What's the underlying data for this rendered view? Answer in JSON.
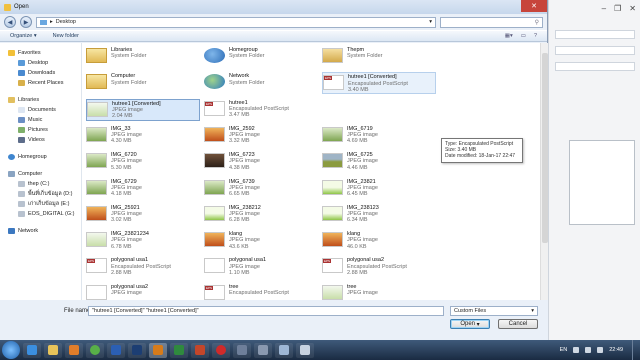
{
  "window": {
    "title": "Open"
  },
  "address": {
    "path": "Desktop",
    "search_placeholder": "Search Desktop"
  },
  "toolbar": {
    "organize": "Organize ▾",
    "new_folder": "New folder"
  },
  "sidebar": {
    "favorites": {
      "label": "Favorites",
      "items": [
        "Desktop",
        "Downloads",
        "Recent Places"
      ]
    },
    "libraries": {
      "label": "Libraries",
      "items": [
        "Documents",
        "Music",
        "Pictures",
        "Videos"
      ]
    },
    "homegroup": "Homegroup",
    "computer": {
      "label": "Computer",
      "items": [
        "thep (C:)",
        "พื้นที่เก็บข้อมูล (D:)",
        "เก่าเก็บข้อมูล (E:)",
        "EOS_DIGITAL (G:)"
      ]
    },
    "network": "Network"
  },
  "files": [
    {
      "name": "Libraries",
      "type": "System Folder",
      "size": "",
      "thumb": "folder"
    },
    {
      "name": "Homegroup",
      "type": "System Folder",
      "size": "",
      "thumb": "home"
    },
    {
      "name": "Thepm",
      "type": "System Folder",
      "size": "",
      "thumb": "user"
    },
    {
      "name": "Computer",
      "type": "System Folder",
      "size": "",
      "thumb": "folder"
    },
    {
      "name": "Network",
      "type": "System Folder",
      "size": "",
      "thumb": "net"
    },
    {
      "name": "hutree1 [Converted]",
      "type": "Encapsulated PostScript",
      "size": "3.40 MB",
      "thumb": "eps"
    },
    {
      "name": "hutree1 [Converted]",
      "type": "JPEG image",
      "size": "2.04 MB",
      "thumb": "lgreen"
    },
    {
      "name": "hutree1",
      "type": "Encapsulated PostScript",
      "size": "3.47 MB",
      "thumb": "eps"
    },
    {
      "name": "",
      "type": "",
      "size": "",
      "thumb": "none"
    },
    {
      "name": "IMG_33",
      "type": "JPEG image",
      "size": "4.30 MB",
      "thumb": "green"
    },
    {
      "name": "IMG_2592",
      "type": "JPEG image",
      "size": "3.32 MB",
      "thumb": "sunset"
    },
    {
      "name": "IMG_6719",
      "type": "JPEG image",
      "size": "4.69 MB",
      "thumb": "green"
    },
    {
      "name": "IMG_6720",
      "type": "JPEG image",
      "size": "5.30 MB",
      "thumb": "green"
    },
    {
      "name": "IMG_6723",
      "type": "JPEG image",
      "size": "4.38 MB",
      "thumb": "dark"
    },
    {
      "name": "IMG_6725",
      "type": "JPEG image",
      "size": "4.46 MB",
      "thumb": "field"
    },
    {
      "name": "IMG_6729",
      "type": "JPEG image",
      "size": "4.18 MB",
      "thumb": "green"
    },
    {
      "name": "IMG_6739",
      "type": "JPEG image",
      "size": "6.65 MB",
      "thumb": "green"
    },
    {
      "name": "IMG_23821",
      "type": "JPEG image",
      "size": "6.45 MB",
      "thumb": "bright"
    },
    {
      "name": "IMG_25921",
      "type": "JPEG image",
      "size": "3.02 MB",
      "thumb": "sunset"
    },
    {
      "name": "IMG_238212",
      "type": "JPEG image",
      "size": "6.28 MB",
      "thumb": "bright"
    },
    {
      "name": "IMG_238123",
      "type": "JPEG image",
      "size": "6.34 MB",
      "thumb": "bright"
    },
    {
      "name": "IMG_23821234",
      "type": "JPEG image",
      "size": "6.78 MB",
      "thumb": "lgreen"
    },
    {
      "name": "klang",
      "type": "JPEG image",
      "size": "43.6 KB",
      "thumb": "sunset"
    },
    {
      "name": "klang",
      "type": "JPEG image",
      "size": "46.0 KB",
      "thumb": "sunset"
    },
    {
      "name": "polygonal usa1",
      "type": "Encapsulated PostScript",
      "size": "2.88 MB",
      "thumb": "eps"
    },
    {
      "name": "polygonal usa1",
      "type": "JPEG image",
      "size": "1.10 MB",
      "thumb": "map"
    },
    {
      "name": "polygonal usa2",
      "type": "Encapsulated PostScript",
      "size": "2.88 MB",
      "thumb": "eps"
    },
    {
      "name": "polygonal usa2",
      "type": "JPEG image",
      "size": "",
      "thumb": "map"
    },
    {
      "name": "tree",
      "type": "Encapsulated PostScript",
      "size": "",
      "thumb": "eps"
    },
    {
      "name": "tree",
      "type": "JPEG image",
      "size": "",
      "thumb": "lgreen"
    }
  ],
  "tooltip": {
    "type": "Type: Encapsulated PostScript",
    "size": "Size: 3.40 MB",
    "modified": "Date modified: 18-Jan-17 22:47"
  },
  "footer": {
    "file_name_label": "File name:",
    "file_name_value": "\"hutree1 [Converted]\" \"hutree1 [Converted]\"",
    "filter": "Custom Files",
    "open": "Open",
    "cancel": "Cancel"
  },
  "taskbar": {
    "lang": "EN",
    "time": "22:49"
  }
}
